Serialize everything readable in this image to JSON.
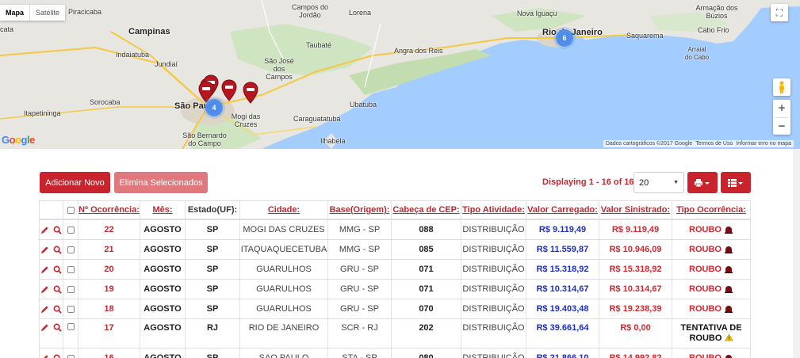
{
  "map": {
    "types": [
      "Mapa",
      "Satélite"
    ],
    "places": [
      {
        "name": "Piracicaba",
        "big": false
      },
      {
        "name": "Campinas",
        "big": true
      },
      {
        "name": "Indaiatuba",
        "big": false
      },
      {
        "name": "Jundiaí",
        "big": false
      },
      {
        "name": "Sorocaba",
        "big": false
      },
      {
        "name": "Itapetininga",
        "big": false
      },
      {
        "name": "São Paulo",
        "big": true
      },
      {
        "name": "São Bernardo do Campo",
        "big": false
      },
      {
        "name": "Mogi das Cruzes",
        "big": false
      },
      {
        "name": "São José dos Campos",
        "big": false
      },
      {
        "name": "Taubaté",
        "big": false
      },
      {
        "name": "Campos do Jordão",
        "big": false
      },
      {
        "name": "Lorena",
        "big": false
      },
      {
        "name": "Caraguatatuba",
        "big": false
      },
      {
        "name": "Ubatuba",
        "big": false
      },
      {
        "name": "Ilhabela",
        "big": false
      },
      {
        "name": "Angra dos Reis",
        "big": false
      },
      {
        "name": "Nova Iguaçu",
        "big": false
      },
      {
        "name": "Rio de Janeiro",
        "big": true
      },
      {
        "name": "Saquarema",
        "big": false
      },
      {
        "name": "Cabo Frio",
        "big": false
      },
      {
        "name": "Armação dos Búzios",
        "big": false
      },
      {
        "name": "Arraial do Cabo",
        "big": false
      },
      {
        "name": "Taubaté",
        "big": false
      },
      {
        "name": "Guaratinguetá",
        "big": false
      },
      {
        "name": "cata",
        "big": false
      }
    ],
    "clusters": [
      "4",
      "6"
    ],
    "roads": [
      "146",
      "381",
      "116",
      "459",
      "101",
      "374",
      "383",
      "116",
      "101"
    ],
    "footer": [
      "Dados cartográficos ©2017 Google",
      "Termos de Uso",
      "Informar erro no mapa"
    ],
    "google_logo": [
      "G",
      "o",
      "o",
      "g",
      "l",
      "e"
    ]
  },
  "toolbar": {
    "add_label": "Adicionar Novo",
    "delete_label": "Elimina Selecionados",
    "displaying": "Displaying 1 - 16 of 16",
    "page_size": "20"
  },
  "table": {
    "headers": [
      "Nº Ocorrência:",
      "Mês:",
      "Estado(UF):",
      "Cidade:",
      "Base(Origem):",
      "Cabeça de CEP:",
      "Tipo Atividade:",
      "Valor Carregado:",
      "Valor Sinistrado:",
      "Tipo Ocorrência:"
    ],
    "rows": [
      {
        "num": "22",
        "mes": "AGOSTO",
        "uf": "SP",
        "cidade": "MOGI DAS CRUZES",
        "base": "MMG - SP",
        "cep": "088",
        "atividade": "DISTRIBUIÇÃO",
        "carregado": "R$ 9.119,49",
        "sinistrado": "R$ 9.119,49",
        "tipo": "ROUBO"
      },
      {
        "num": "21",
        "mes": "AGOSTO",
        "uf": "SP",
        "cidade": "ITAQUAQUECETUBA",
        "base": "MMG - SP",
        "cep": "085",
        "atividade": "DISTRIBUIÇÃO",
        "carregado": "R$ 11.559,87",
        "sinistrado": "R$ 10.946,09",
        "tipo": "ROUBO"
      },
      {
        "num": "20",
        "mes": "AGOSTO",
        "uf": "SP",
        "cidade": "GUARULHOS",
        "base": "GRU - SP",
        "cep": "071",
        "atividade": "DISTRIBUIÇÃO",
        "carregado": "R$ 15.318,92",
        "sinistrado": "R$ 15.318,92",
        "tipo": "ROUBO"
      },
      {
        "num": "19",
        "mes": "AGOSTO",
        "uf": "SP",
        "cidade": "GUARULHOS",
        "base": "GRU - SP",
        "cep": "071",
        "atividade": "DISTRIBUIÇÃO",
        "carregado": "R$ 10.314,67",
        "sinistrado": "R$ 10.314,67",
        "tipo": "ROUBO"
      },
      {
        "num": "18",
        "mes": "AGOSTO",
        "uf": "SP",
        "cidade": "GUARULHOS",
        "base": "GRU - SP",
        "cep": "070",
        "atividade": "DISTRIBUIÇÃO",
        "carregado": "R$ 19.403,48",
        "sinistrado": "R$ 19.238,39",
        "tipo": "ROUBO"
      },
      {
        "num": "17",
        "mes": "AGOSTO",
        "uf": "RJ",
        "cidade": "RIO DE JANEIRO",
        "base": "SCR - RJ",
        "cep": "202",
        "atividade": "DISTRIBUIÇÃO",
        "carregado": "R$ 39.661,64",
        "sinistrado": "R$ 0,00",
        "tipo_line1": "TENTATIVA DE",
        "tipo_line2": "ROUBO"
      },
      {
        "num": "16",
        "mes": "AGOSTO",
        "uf": "SP",
        "cidade": "SAO PAULO",
        "base": "STA - SP",
        "cep": "080",
        "atividade": "DISTRIBUIÇÃO",
        "carregado": "R$ 21.866,10",
        "sinistrado": "R$ 14.992,82",
        "tipo": "ROUBO"
      }
    ]
  },
  "colors": {
    "accent": "#c9242e",
    "accent_light": "#e0787d",
    "link": "#b52a33",
    "blue_value": "#1d2fc9",
    "red_value": "#d8262e",
    "water": "#a3ccff",
    "land": "#e8e6e0"
  }
}
